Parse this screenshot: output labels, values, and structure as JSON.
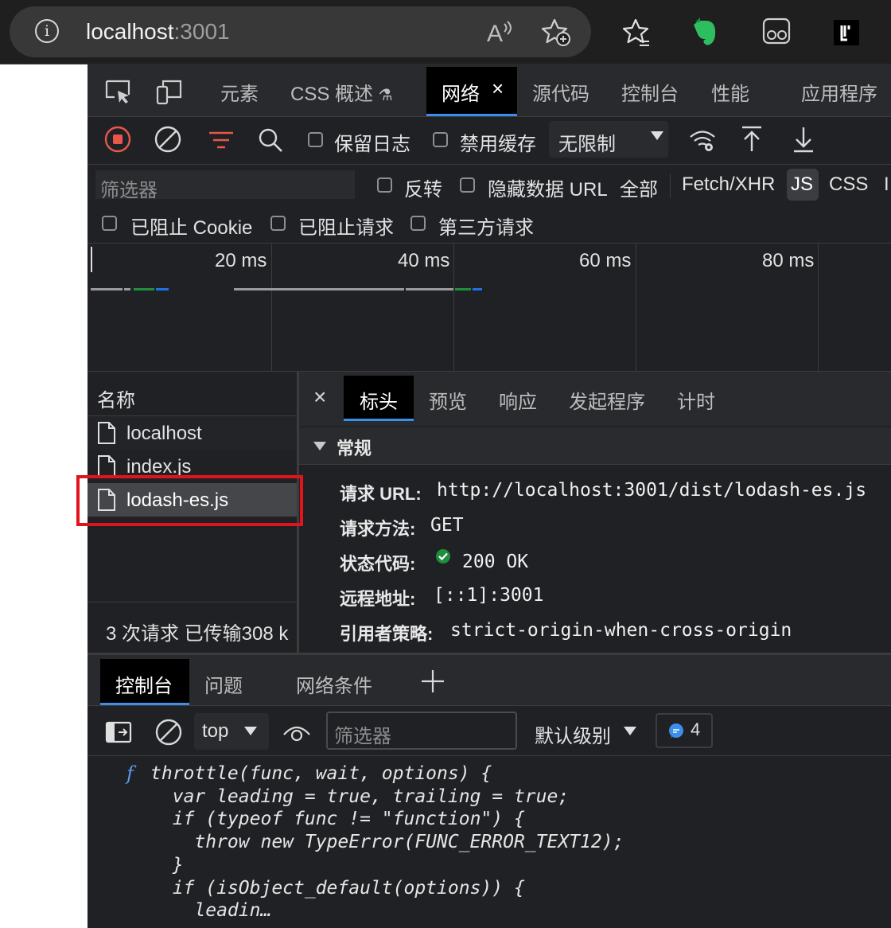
{
  "browser": {
    "url_host": "localhost",
    "url_port": ":3001",
    "icons": [
      "info-icon",
      "read-aloud-icon",
      "add-favorite-icon",
      "favorites-icon",
      "evernote-icon",
      "reading-mode-icon",
      "extension-icon"
    ]
  },
  "devtools": {
    "main_tabs": [
      "元素",
      "CSS 概述",
      "网络",
      "源代码",
      "控制台",
      "性能",
      "应用程序"
    ],
    "selected_main_tab": "网络",
    "toolbar": {
      "preserve_log": "保留日志",
      "disable_cache": "禁用缓存",
      "throttle": "无限制"
    },
    "filter": {
      "placeholder": "筛选器",
      "invert": "反转",
      "hide_data_url": "隐藏数据 URL",
      "types": [
        "全部",
        "Fetch/XHR",
        "JS",
        "CSS",
        "I"
      ],
      "selected_type": "JS",
      "blocked_cookies": "已阻止 Cookie",
      "blocked_requests": "已阻止请求",
      "third_party": "第三方请求"
    },
    "timeline": {
      "ticks": [
        "20 ms",
        "40 ms",
        "60 ms",
        "80 ms"
      ]
    },
    "requests": {
      "header": "名称",
      "items": [
        "localhost",
        "index.js",
        "lodash-es.js"
      ],
      "selected": "lodash-es.js",
      "summary": "3 次请求  已传输308 k"
    },
    "detail": {
      "tabs": [
        "标头",
        "预览",
        "响应",
        "发起程序",
        "计时"
      ],
      "selected_tab": "标头",
      "section_title": "常规",
      "rows": [
        {
          "key": "请求 URL:",
          "value": "http://localhost:3001/dist/lodash-es.js"
        },
        {
          "key": "请求方法:",
          "value": "GET"
        },
        {
          "key": "状态代码:",
          "value": "200 OK"
        },
        {
          "key": "远程地址:",
          "value": "[::1]:3001"
        },
        {
          "key": "引用者策略:",
          "value": "strict-origin-when-cross-origin"
        }
      ]
    },
    "drawer": {
      "tabs": [
        "控制台",
        "问题",
        "网络条件"
      ],
      "selected_tab": "控制台",
      "context": "top",
      "filter_placeholder": "筛选器",
      "level": "默认级别",
      "message_count": "4"
    },
    "console_code": [
      "throttle(func, wait, options) {",
      "  var leading = true, trailing = true;",
      "  if (typeof func != \"function\") {",
      "    throw new TypeError(FUNC_ERROR_TEXT12);",
      "  }",
      "  if (isObject_default(options)) {",
      "    leadin…"
    ],
    "code_prefix": "f"
  },
  "colors": {
    "accent": "#3b8eea",
    "record": "#e8574a",
    "highlight_box": "#e3131b",
    "status_ok": "#1e8e3e"
  }
}
